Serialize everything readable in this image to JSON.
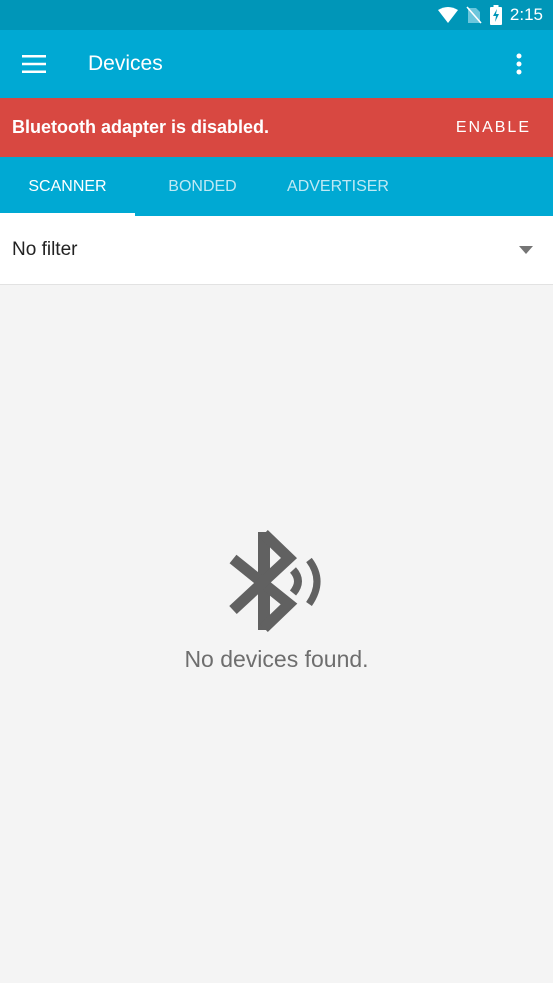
{
  "status_bar": {
    "time": "2:15",
    "icons": [
      "wifi-icon",
      "no-sim-icon",
      "battery-charging-icon"
    ]
  },
  "app_bar": {
    "title": "Devices",
    "menu_icon": "hamburger-menu-icon",
    "overflow_icon": "more-vert-icon"
  },
  "banner": {
    "message": "Bluetooth adapter is disabled.",
    "action": "ENABLE"
  },
  "tabs": [
    {
      "label": "SCANNER",
      "active": true
    },
    {
      "label": "BONDED",
      "active": false
    },
    {
      "label": "ADVERTISER",
      "active": false
    }
  ],
  "filter": {
    "selected": "No filter",
    "dropdown_icon": "arrow-drop-down-icon"
  },
  "empty_state": {
    "icon": "bluetooth-searching-icon",
    "message": "No devices found."
  },
  "colors": {
    "primary": "#00a9d3",
    "primary_dark": "#0096b8",
    "banner": "#d84841",
    "background": "#f4f4f4"
  }
}
